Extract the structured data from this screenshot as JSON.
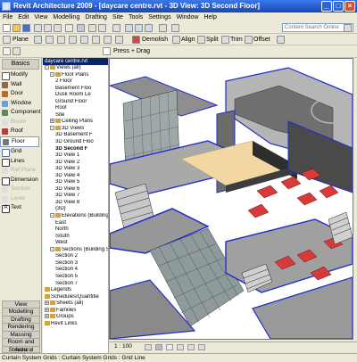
{
  "window": {
    "title": "Revit Architecture 2009 - [daycare centre.rvt - 3D View: 3D Second Floor]"
  },
  "menu": [
    "File",
    "Edit",
    "View",
    "Modelling",
    "Drafting",
    "Site",
    "Tools",
    "Settings",
    "Window",
    "Help"
  ],
  "toolbar1": {
    "search_placeholder": "Content Search Online"
  },
  "toolbar2": {
    "plane": "Plane",
    "demolish": "Demolish",
    "align": "Align",
    "split": "Split",
    "trim": "Trim",
    "offset": "Offset"
  },
  "toolbar3": {
    "press_drag": "Press + Drag"
  },
  "designbar": {
    "header": "Basics",
    "items": [
      {
        "label": "Modify",
        "icon": "arrow-icon"
      },
      {
        "label": "Wall",
        "icon": "wall-icon"
      },
      {
        "label": "Door",
        "icon": "door-icon"
      },
      {
        "label": "Window",
        "icon": "window-icon"
      },
      {
        "label": "Component",
        "icon": "component-icon"
      },
      {
        "label": "Room",
        "icon": "room-icon",
        "disabled": true
      },
      {
        "label": "Roof",
        "icon": "roof-icon"
      },
      {
        "label": "Floor",
        "icon": "floor-icon",
        "active": true
      },
      {
        "label": "Grid",
        "icon": "grid-icon"
      },
      {
        "label": "Lines",
        "icon": "lines-icon"
      },
      {
        "label": "Ref Plane",
        "icon": "ref-plane-icon",
        "disabled": true
      },
      {
        "label": "Dimension",
        "icon": "dimension-icon"
      },
      {
        "label": "Section",
        "icon": "section-icon",
        "disabled": true
      },
      {
        "label": "Level",
        "icon": "level-icon",
        "disabled": true
      },
      {
        "label": "Text",
        "icon": "text-icon"
      }
    ],
    "tabs": [
      "View",
      "Modelling",
      "Drafting",
      "Rendering",
      "Massing",
      "Room and Area",
      "Structural"
    ]
  },
  "browser": {
    "header": "daycare centre.rvt",
    "tree": [
      {
        "label": "Views (all)",
        "level": 0,
        "toggle": "-"
      },
      {
        "label": "Floor Plans",
        "level": 1,
        "toggle": "-"
      },
      {
        "label": "2 Floor",
        "level": 2
      },
      {
        "label": "Basement Floo",
        "level": 2
      },
      {
        "label": "Dusk Room Le",
        "level": 2
      },
      {
        "label": "Ground Floor",
        "level": 2
      },
      {
        "label": "Roof",
        "level": 2
      },
      {
        "label": "Site",
        "level": 2
      },
      {
        "label": "Ceiling Plans",
        "level": 1,
        "toggle": "+"
      },
      {
        "label": "3D Views",
        "level": 1,
        "toggle": "-"
      },
      {
        "label": "3D Basement F",
        "level": 2
      },
      {
        "label": "3D Ground Floo",
        "level": 2
      },
      {
        "label": "3D Second F",
        "level": 2,
        "bold": true
      },
      {
        "label": "3D View 1",
        "level": 2
      },
      {
        "label": "3D View 2",
        "level": 2
      },
      {
        "label": "3D View 3",
        "level": 2
      },
      {
        "label": "3D View 4",
        "level": 2
      },
      {
        "label": "3D View 5",
        "level": 2
      },
      {
        "label": "3D View 6",
        "level": 2
      },
      {
        "label": "3D View 7",
        "level": 2
      },
      {
        "label": "3D View 8",
        "level": 2
      },
      {
        "label": "{3D}",
        "level": 2
      },
      {
        "label": "Elevations (Building",
        "level": 1,
        "toggle": "-"
      },
      {
        "label": "East",
        "level": 2
      },
      {
        "label": "North",
        "level": 2
      },
      {
        "label": "South",
        "level": 2
      },
      {
        "label": "West",
        "level": 2
      },
      {
        "label": "Sections (Building S",
        "level": 1,
        "toggle": "-"
      },
      {
        "label": "Section 2",
        "level": 2
      },
      {
        "label": "Section 3",
        "level": 2
      },
      {
        "label": "Section 4",
        "level": 2
      },
      {
        "label": "Section 5",
        "level": 2
      },
      {
        "label": "Section 7",
        "level": 2
      },
      {
        "label": "Legends",
        "level": 0
      },
      {
        "label": "Schedules/Quantitie",
        "level": 0
      },
      {
        "label": "Sheets (all)",
        "level": 0,
        "toggle": "+"
      },
      {
        "label": "Families",
        "level": 0,
        "toggle": "+"
      },
      {
        "label": "Groups",
        "level": 0,
        "toggle": "+"
      },
      {
        "label": "Revit Links",
        "level": 0
      }
    ]
  },
  "viewcontrol": {
    "scale": "1 : 100"
  },
  "status": "Curtain System Grids : Curtain System Grids : Grid Line",
  "colors": {
    "title_start": "#3a7ae8",
    "title_end": "#1747b7",
    "selection": "#0a246a",
    "blue_edge": "#1f2dcc",
    "table_red": "#d83a3a",
    "floor_tan": "#f2d7a2"
  }
}
